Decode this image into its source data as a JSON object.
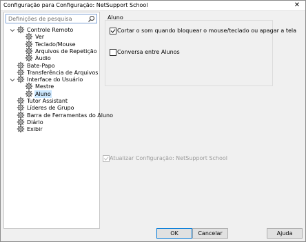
{
  "window": {
    "title": "Configuração para Configuração: NetSupport School",
    "close_glyph": "✕"
  },
  "search": {
    "placeholder": "Definições de pesquisa",
    "icon": "search-icon"
  },
  "tree": {
    "items": [
      {
        "label": "Controle Remoto",
        "level": 0,
        "expanded": true,
        "selected": false,
        "icon": "gear-icon"
      },
      {
        "label": "Ver",
        "level": 1,
        "selected": false,
        "icon": "gear-icon"
      },
      {
        "label": "Teclado/Mouse",
        "level": 1,
        "selected": false,
        "icon": "gear-icon"
      },
      {
        "label": "Arquivos de Repetição",
        "level": 1,
        "selected": false,
        "icon": "gear-icon"
      },
      {
        "label": "Áudio",
        "level": 1,
        "selected": false,
        "icon": "gear-icon"
      },
      {
        "label": "Bate-Papo",
        "level": 0,
        "selected": false,
        "icon": "gear-icon"
      },
      {
        "label": "Transferência de Arquivos",
        "level": 0,
        "selected": false,
        "icon": "gear-icon"
      },
      {
        "label": "Interface do Usuário",
        "level": 0,
        "expanded": true,
        "selected": false,
        "icon": "gear-icon"
      },
      {
        "label": "Mestre",
        "level": 1,
        "selected": false,
        "icon": "gear-icon"
      },
      {
        "label": "Aluno",
        "level": 1,
        "selected": true,
        "icon": "gear-icon"
      },
      {
        "label": "Tutor Assistant",
        "level": 0,
        "selected": false,
        "icon": "gear-icon"
      },
      {
        "label": "Líderes de Grupo",
        "level": 0,
        "selected": false,
        "icon": "gear-icon"
      },
      {
        "label": "Barra de Ferramentas do Aluno",
        "level": 0,
        "selected": false,
        "icon": "gear-icon"
      },
      {
        "label": "Diário",
        "level": 0,
        "selected": false,
        "icon": "gear-icon"
      },
      {
        "label": "Exibir",
        "level": 0,
        "selected": false,
        "icon": "gear-icon"
      }
    ]
  },
  "panel": {
    "group_title": "Aluno",
    "options": [
      {
        "label": "Cortar o som quando bloquear o mouse/teclado ou apagar a tela",
        "checked": true
      },
      {
        "label": "Conversa entre Alunos",
        "checked": false
      }
    ],
    "update_config": {
      "label": "Atualizar Configuração: NetSupport School",
      "checked": true,
      "disabled": true
    }
  },
  "buttons": {
    "ok": "OK",
    "cancel": "Cancelar",
    "help": "Ajuda"
  },
  "colors": {
    "selection": "#cce8ff",
    "focus_border": "#0078d7"
  }
}
